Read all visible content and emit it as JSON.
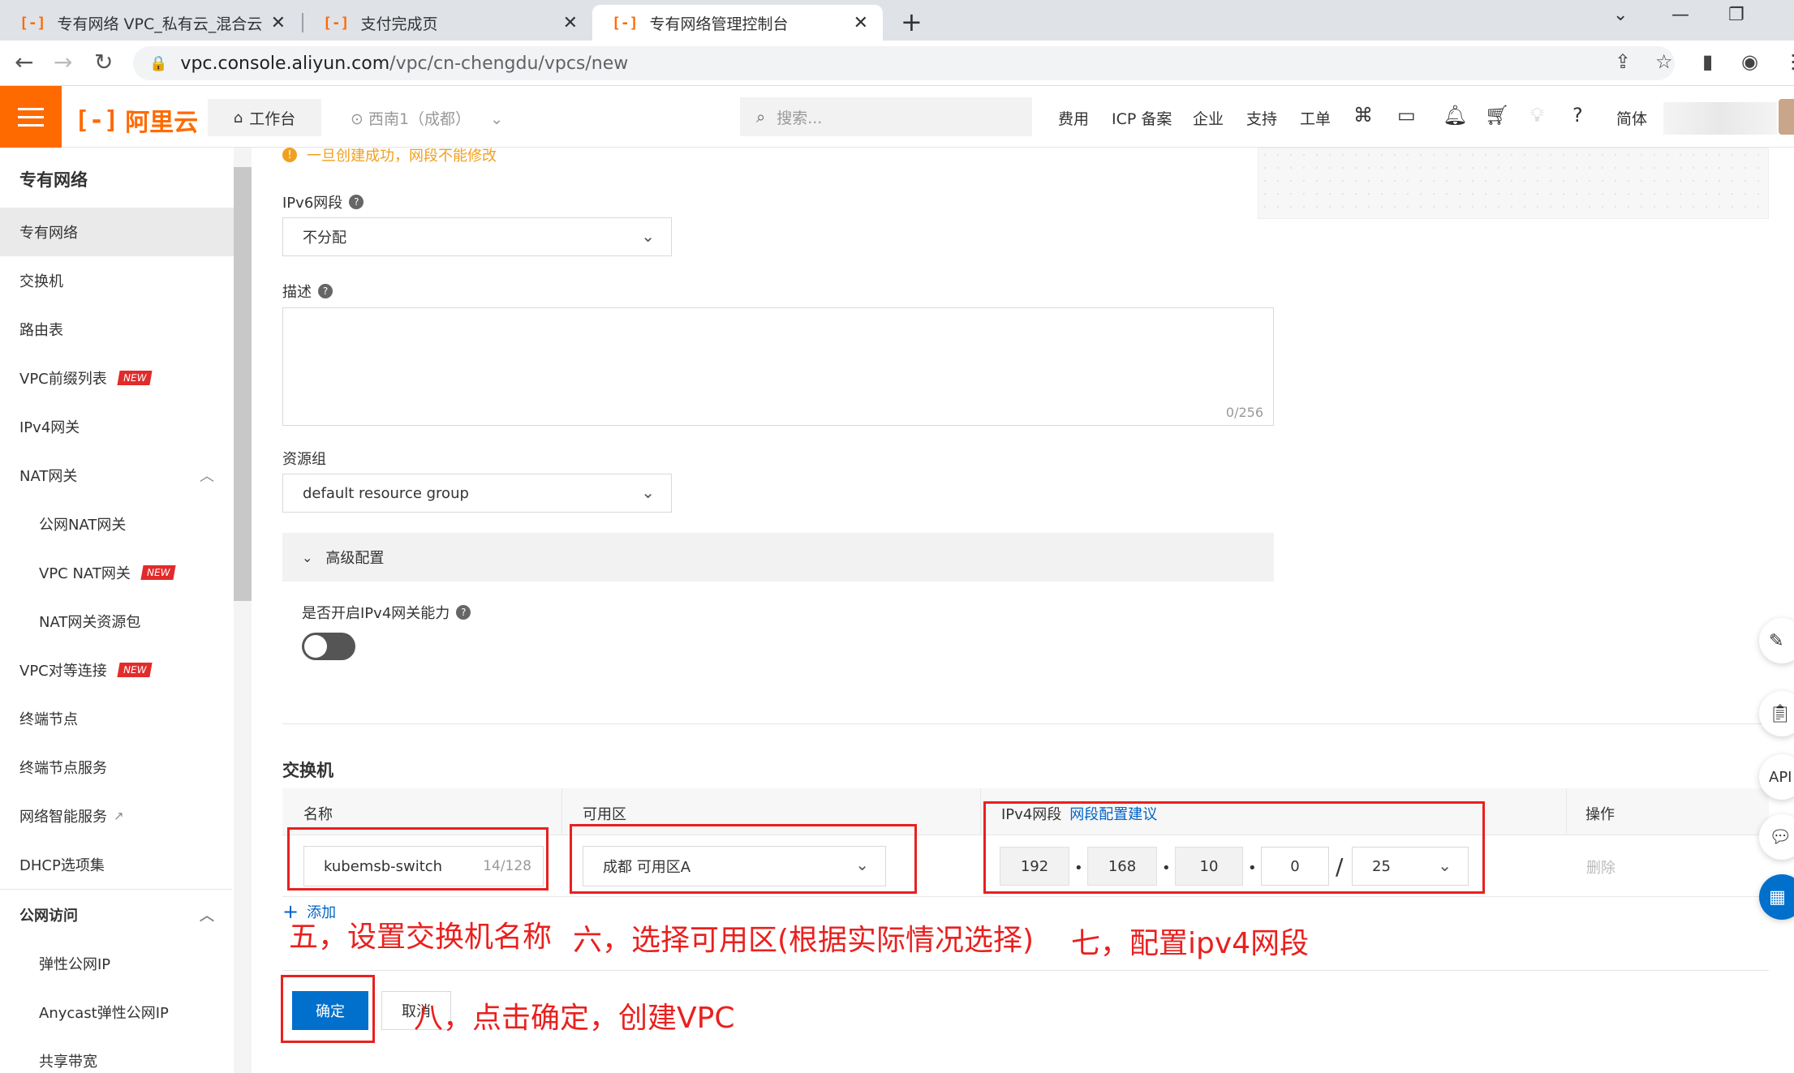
{
  "browser": {
    "tabs": [
      {
        "title": "专有网络 VPC_私有云_混合云架",
        "close": "✕"
      },
      {
        "title": "支付完成页",
        "close": "✕"
      },
      {
        "title": "专有网络管理控制台",
        "close": "✕"
      }
    ],
    "tab_logo": "[-]",
    "new_tab": "+",
    "url_host": "vpc.console.aliyun.com",
    "url_path": "/vpc/cn-chengdu/vpcs/new"
  },
  "header": {
    "logo_text": "阿里云",
    "workbench": "工作台",
    "region": "西南1（成都）",
    "search_placeholder": "搜索...",
    "nav": [
      "费用",
      "ICP 备案",
      "企业",
      "支持",
      "工单"
    ],
    "lang": "简体"
  },
  "sidebar": {
    "title": "专有网络",
    "items": [
      {
        "label": "专有网络",
        "active": true
      },
      {
        "label": "交换机"
      },
      {
        "label": "路由表"
      },
      {
        "label": "VPC前缀列表",
        "badge": "NEW"
      },
      {
        "label": "IPv4网关"
      },
      {
        "label": "NAT网关"
      },
      {
        "label": "公网NAT网关"
      },
      {
        "label": "VPC NAT网关",
        "badge": "NEW"
      },
      {
        "label": "NAT网关资源包"
      },
      {
        "label": "VPC对等连接",
        "badge": "NEW"
      },
      {
        "label": "终端节点"
      },
      {
        "label": "终端节点服务"
      },
      {
        "label": "网络智能服务"
      },
      {
        "label": "DHCP选项集"
      },
      {
        "label": "公网访问"
      },
      {
        "label": "弹性公网IP"
      },
      {
        "label": "Anycast弹性公网IP"
      },
      {
        "label": "共享带宽"
      }
    ]
  },
  "form": {
    "warning": "一旦创建成功，网段不能修改",
    "ipv6_label": "IPv6网段",
    "ipv6_value": "不分配",
    "desc_label": "描述",
    "desc_counter": "0/256",
    "rg_label": "资源组",
    "rg_value": "default resource group",
    "advanced_label": "高级配置",
    "ipv4gw_label": "是否开启IPv4网关能力",
    "ipv4gw_enabled": false
  },
  "switch_section": {
    "title": "交换机",
    "columns": {
      "name": "名称",
      "zone": "可用区",
      "ipv4": "IPv4网段",
      "ipv4_link": "网段配置建议",
      "action": "操作"
    },
    "row": {
      "name": "kubemsb-switch",
      "name_counter": "14/128",
      "zone": "成都 可用区A",
      "ip": [
        "192",
        "168",
        "10",
        "0"
      ],
      "mask": "25",
      "delete": "删除"
    },
    "add": "添加"
  },
  "buttons": {
    "confirm": "确定",
    "cancel": "取消"
  },
  "annotations": {
    "step5": "五，设置交换机名称",
    "step6": "六，选择可用区(根据实际情况选择)",
    "step7": "七，配置ipv4网段",
    "step8": "八，点击确定，创建VPC"
  },
  "colors": {
    "brand": "#ff6a00",
    "primary": "#0070cc",
    "annotation": "#e8211f"
  }
}
